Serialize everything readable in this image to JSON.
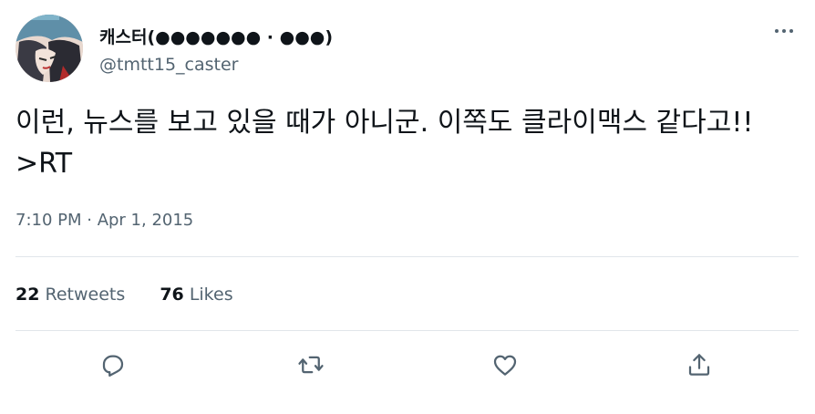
{
  "author": {
    "name": "캐스터(●●●●●●● · ●●●)",
    "handle": "@tmtt15_caster"
  },
  "tweet": {
    "text": "이런, 뉴스를 보고 있을 때가 아니군. 이쪽도 클라이맥스 같다고!! >RT",
    "timestamp": "7:10 PM · Apr 1, 2015"
  },
  "stats": {
    "retweets_count": "22",
    "retweets_label": "Retweets",
    "likes_count": "76",
    "likes_label": "Likes"
  },
  "actions": [
    "reply-icon",
    "retweet-icon",
    "like-icon",
    "share-icon"
  ],
  "colors": {
    "text_primary": "#0f1419",
    "text_secondary": "#536471",
    "divider": "#e1e6ea"
  }
}
